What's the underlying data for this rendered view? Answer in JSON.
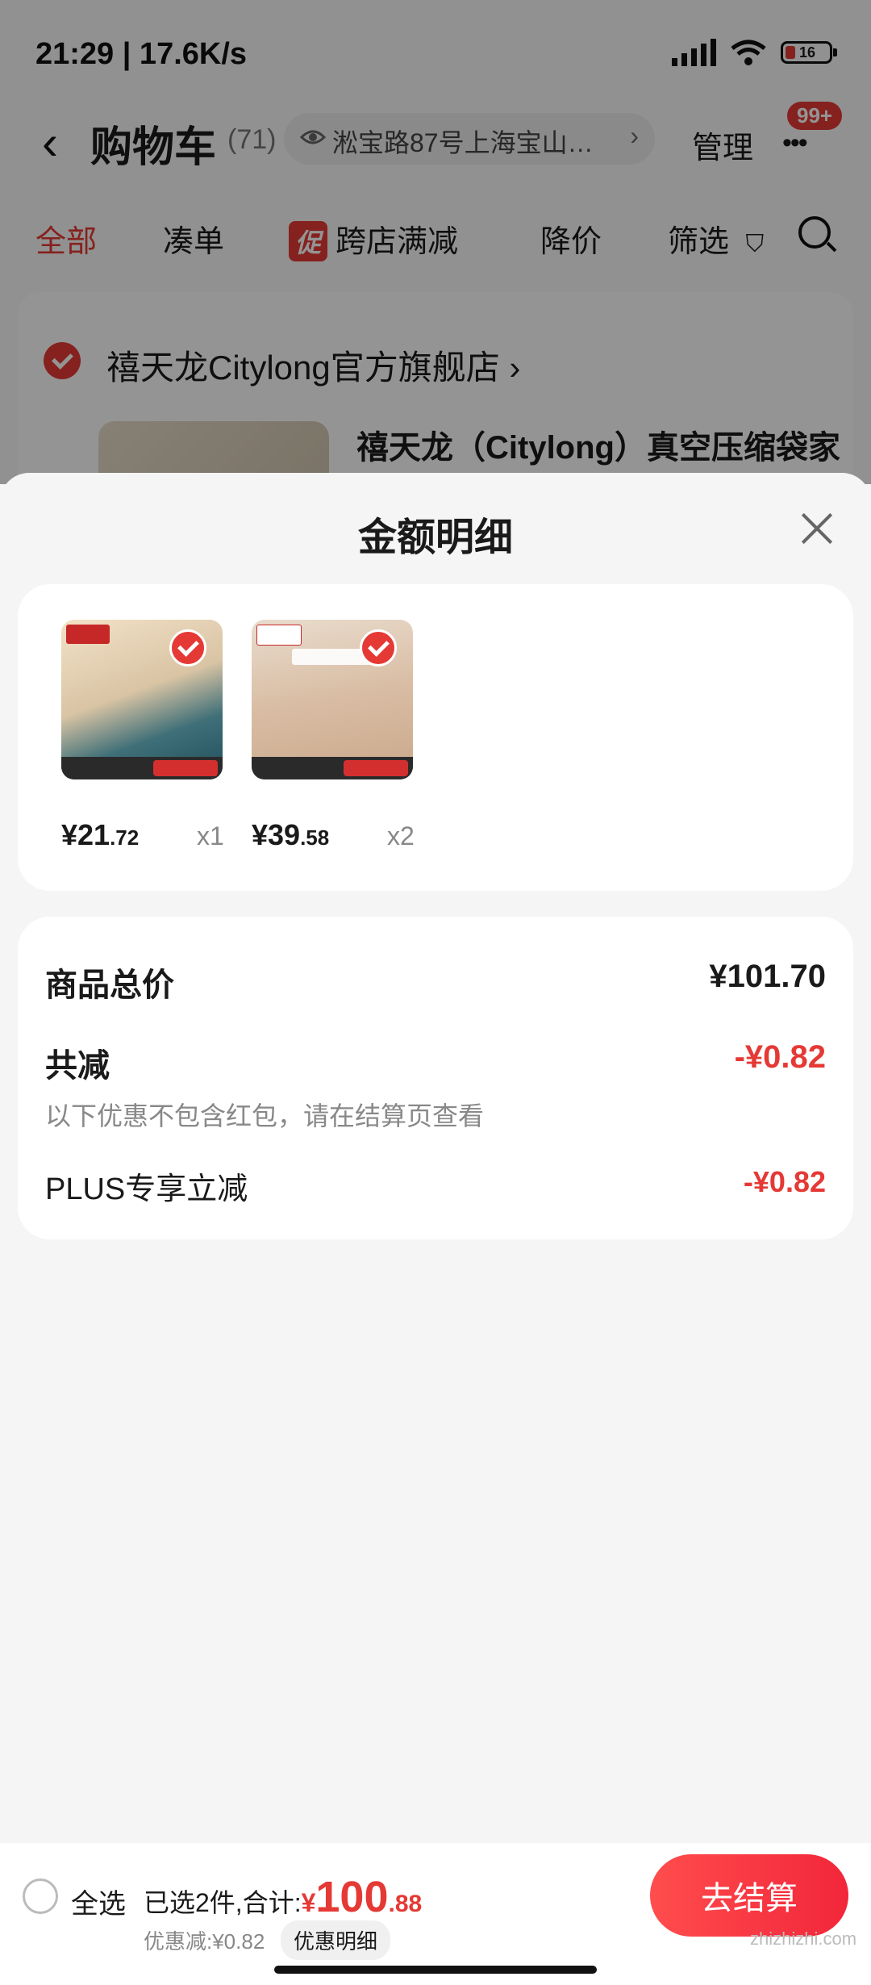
{
  "status": {
    "time": "21:29 | 17.6K/s",
    "battery": "16"
  },
  "nav": {
    "title": "购物车",
    "count": "(71)",
    "address": "淞宝路87号上海宝山…",
    "manage": "管理",
    "badge": "99+"
  },
  "tabs": {
    "all": "全部",
    "combine": "凑单",
    "promo_tag": "促",
    "cross_store": "跨店满减",
    "price_drop": "降价",
    "filter": "筛选"
  },
  "store": {
    "name": "禧天龙Citylong官方旗舰店",
    "product_title": "禧天龙（Citylong）真空压缩袋家"
  },
  "sheet": {
    "title": "金额明细",
    "items": [
      {
        "price_int": "¥21",
        "price_dec": ".72",
        "qty": "x1"
      },
      {
        "price_int": "¥39",
        "price_dec": ".58",
        "qty": "x2"
      }
    ],
    "summary": {
      "total_label": "商品总价",
      "total_value": "¥101.70",
      "reduce_label": "共减",
      "reduce_value": "-¥0.82",
      "note": "以下优惠不包含红包，请在结算页查看",
      "plus_label": "PLUS专享立减",
      "plus_value": "-¥0.82"
    }
  },
  "bottom": {
    "select_all": "全选",
    "selected_text": "已选2件,合计:",
    "total_yen": "¥",
    "total_int": "100",
    "total_dec": ".88",
    "discount": "优惠减:¥0.82",
    "discount_detail": "优惠明细",
    "checkout": "去结算",
    "watermark": "zhizhizhi.com"
  },
  "colors": {
    "accent": "#e53935"
  }
}
